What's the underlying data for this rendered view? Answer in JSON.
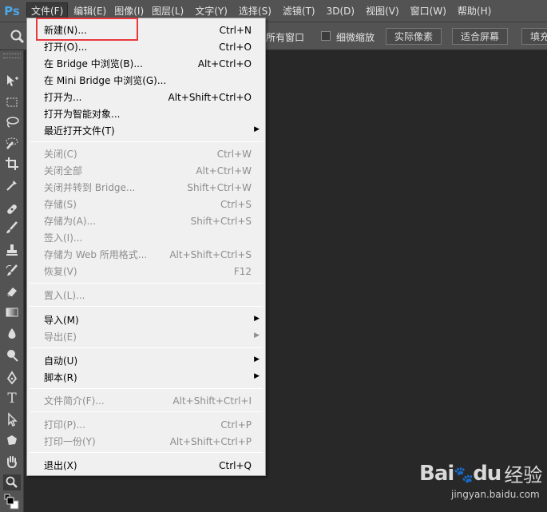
{
  "app": {
    "logo": "Ps"
  },
  "menubar": [
    {
      "label": "文件(F)",
      "active": true
    },
    {
      "label": "编辑(E)"
    },
    {
      "label": "图像(I)"
    },
    {
      "label": "图层(L)"
    },
    {
      "label": "文字(Y)"
    },
    {
      "label": "选择(S)"
    },
    {
      "label": "滤镜(T)"
    },
    {
      "label": "3D(D)"
    },
    {
      "label": "视图(V)"
    },
    {
      "label": "窗口(W)"
    },
    {
      "label": "帮助(H)"
    }
  ],
  "options": {
    "tool_icon": "zoom-icon",
    "text_all_windows": "放所有窗口",
    "scrubby_zoom_label": "细微缩放",
    "btn_actual_pixels": "实际像素",
    "btn_fit_screen": "适合屏幕",
    "btn_fill_screen": "填充"
  },
  "file_menu": {
    "new": {
      "label": "新建(N)...",
      "shortcut": "Ctrl+N"
    },
    "open": {
      "label": "打开(O)...",
      "shortcut": "Ctrl+O"
    },
    "browse_bridge": {
      "label": "在 Bridge 中浏览(B)...",
      "shortcut": "Alt+Ctrl+O"
    },
    "browse_mini_bridge": {
      "label": "在 Mini Bridge 中浏览(G)...",
      "shortcut": ""
    },
    "open_as": {
      "label": "打开为...",
      "shortcut": "Alt+Shift+Ctrl+O"
    },
    "open_smart": {
      "label": "打开为智能对象...",
      "shortcut": ""
    },
    "recent": {
      "label": "最近打开文件(T)",
      "shortcut": ""
    },
    "close": {
      "label": "关闭(C)",
      "shortcut": "Ctrl+W"
    },
    "close_all": {
      "label": "关闭全部",
      "shortcut": "Alt+Ctrl+W"
    },
    "close_to_bridge": {
      "label": "关闭并转到 Bridge...",
      "shortcut": "Shift+Ctrl+W"
    },
    "save": {
      "label": "存储(S)",
      "shortcut": "Ctrl+S"
    },
    "save_as": {
      "label": "存储为(A)...",
      "shortcut": "Shift+Ctrl+S"
    },
    "check_in": {
      "label": "签入(I)...",
      "shortcut": ""
    },
    "save_web": {
      "label": "存储为 Web 所用格式...",
      "shortcut": "Alt+Shift+Ctrl+S"
    },
    "revert": {
      "label": "恢复(V)",
      "shortcut": "F12"
    },
    "place": {
      "label": "置入(L)...",
      "shortcut": ""
    },
    "import": {
      "label": "导入(M)",
      "shortcut": ""
    },
    "export": {
      "label": "导出(E)",
      "shortcut": ""
    },
    "automate": {
      "label": "自动(U)",
      "shortcut": ""
    },
    "scripts": {
      "label": "脚本(R)",
      "shortcut": ""
    },
    "file_info": {
      "label": "文件简介(F)...",
      "shortcut": "Alt+Shift+Ctrl+I"
    },
    "print": {
      "label": "打印(P)...",
      "shortcut": "Ctrl+P"
    },
    "print_one": {
      "label": "打印一份(Y)",
      "shortcut": "Alt+Shift+Ctrl+P"
    },
    "exit": {
      "label": "退出(X)",
      "shortcut": "Ctrl+Q"
    }
  },
  "watermark": {
    "logo": "Bai",
    "logo2": "du",
    "cn": "经验",
    "url": "jingyan.baidu.com"
  },
  "colors": {
    "highlight": "#e8383d",
    "menu_bg": "#f0f0f0",
    "ui_bg": "#535353",
    "canvas_bg": "#282828"
  }
}
